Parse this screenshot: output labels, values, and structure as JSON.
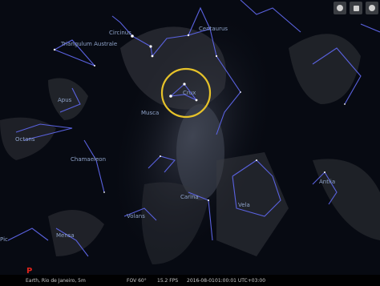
{
  "constellations": {
    "circinus": "Circinus",
    "centaurus": "Centaurus",
    "triangulum_australe": "Triangulum Australe",
    "crux": "Crux",
    "musca": "Musca",
    "apus": "Apus",
    "octans": "Octans",
    "chamaeleon": "Chamaeleon",
    "carina": "Carina",
    "vela": "Vela",
    "antlia": "Antlia",
    "volans": "Volans",
    "mensa": "Mensa",
    "piscis_left": "Pic"
  },
  "cardinal_point": "P",
  "status": {
    "location": "Earth, Rio de Janeiro, 5m",
    "fov": "FOV 60°",
    "fps": "15.2 FPS",
    "date": "2016-08-01",
    "time": "01:00:01 UTC+03:00"
  },
  "colors": {
    "constellation_lines": "#5a62e0",
    "selection_circle": "#e6c22a",
    "cardinal": "#e0241b"
  },
  "toolbar_icons": [
    "record-icon",
    "window-icon",
    "fullscreen-icon"
  ]
}
